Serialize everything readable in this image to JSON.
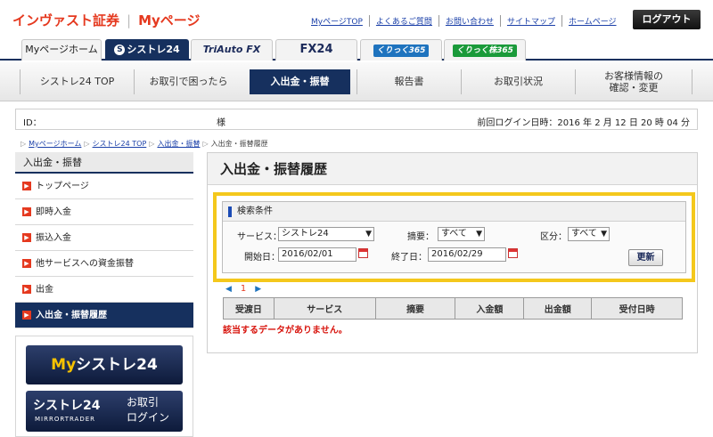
{
  "header": {
    "brand": "インヴァスト証券",
    "brand_sub": "Myページ",
    "top_links": [
      "MyページTOP",
      "よくあるご質問",
      "お問い合わせ",
      "サイトマップ",
      "ホームページ"
    ],
    "logout": "ログアウト"
  },
  "product_tabs": {
    "home": "Myページホーム",
    "systre": "シストレ24",
    "triauto": "TriAuto FX",
    "fx24": "FX24",
    "kurikku365": "くりっく365",
    "kurikku_kabu365": "くりっく株365"
  },
  "main_nav": [
    "シストレ24 TOP",
    "お取引で困ったら",
    "入出金・振替",
    "報告書",
    "お取引状況",
    "お客様情報の",
    "確認・変更"
  ],
  "user_bar": {
    "id_label": "ID：",
    "sama": "様",
    "last_login": "前回ログイン日時：2016 年 2 月 12 日 20 時 04 分"
  },
  "breadcrumb": [
    "Myページホーム",
    "シストレ24 TOP",
    "入出金・振替",
    "入出金・振替履歴"
  ],
  "sidebar": {
    "heading": "入出金・振替",
    "items": [
      "トップページ",
      "即時入金",
      "振込入金",
      "他サービスへの資金振替",
      "出金",
      "入出金・振替履歴"
    ],
    "banner1_my": "My",
    "banner1_rest": "シストレ24",
    "banner2_title": "シストレ24",
    "banner2_sub": "MIRRORTRADER",
    "banner2_line1": "お取引",
    "banner2_line2": "ログイン"
  },
  "main": {
    "title": "入出金・振替履歴",
    "search_caption": "検索条件",
    "service_label": "サービス：",
    "service_value": "シストレ24",
    "summary_label": "摘要：",
    "summary_value": "すべて",
    "category_label": "区分：",
    "category_value": "すべて",
    "start_label": "開始日：",
    "start_value": "2016/02/01",
    "end_label": "終了日：",
    "end_value": "2016/02/29",
    "update_button": "更新",
    "page_number": "1",
    "columns": [
      "受渡日",
      "サービス",
      "摘要",
      "入金額",
      "出金額",
      "受付日時"
    ],
    "no_data": "該当するデータがありません。"
  },
  "colors": {
    "accent": "#e5391f",
    "nav_active": "#16305e",
    "highlight": "#f4c81c"
  }
}
